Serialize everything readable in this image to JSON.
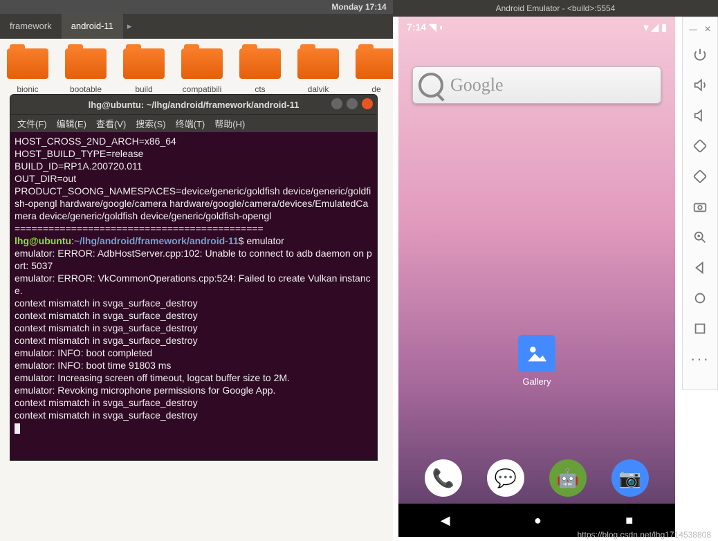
{
  "topbar": {
    "clock": "Monday  17:14"
  },
  "tabs": {
    "framework": "framework",
    "android11": "android-11",
    "arrow": "▸"
  },
  "folders": [
    "bionic",
    "bootable",
    "build",
    "compatibili",
    "cts",
    "dalvik",
    "de"
  ],
  "terminal": {
    "title": "lhg@ubuntu: ~/lhg/android/framework/android-11",
    "menus": [
      "文件(F)",
      "编辑(E)",
      "查看(V)",
      "搜索(S)",
      "终端(T)",
      "帮助(H)"
    ],
    "pre": "HOST_CROSS_2ND_ARCH=x86_64\nHOST_BUILD_TYPE=release\nBUILD_ID=RP1A.200720.011\nOUT_DIR=out\nPRODUCT_SOONG_NAMESPACES=device/generic/goldfish device/generic/goldfish-opengl hardware/google/camera hardware/google/camera/devices/EmulatedCamera device/generic/goldfish device/generic/goldfish-opengl\n============================================",
    "user": "lhg@ubuntu",
    "colon": ":",
    "path": "~/lhg/android/framework/android-11",
    "cmd": "$ emulator",
    "post": "emulator: ERROR: AdbHostServer.cpp:102: Unable to connect to adb daemon on port: 5037\nemulator: ERROR: VkCommonOperations.cpp:524: Failed to create Vulkan instance.\ncontext mismatch in svga_surface_destroy\ncontext mismatch in svga_surface_destroy\ncontext mismatch in svga_surface_destroy\ncontext mismatch in svga_surface_destroy\nemulator: INFO: boot completed\nemulator: INFO: boot time 91803 ms\nemulator: Increasing screen off timeout, logcat buffer size to 2M.\nemulator: Revoking microphone permissions for Google App.\ncontext mismatch in svga_surface_destroy\ncontext mismatch in svga_surface_destroy"
  },
  "emulator": {
    "title": "Android Emulator - <build>:5554",
    "status_time": "7:14",
    "search_placeholder": "Google",
    "gallery_label": "Gallery"
  },
  "watermark": "https://blog.csdn.net/lhg1714538808"
}
